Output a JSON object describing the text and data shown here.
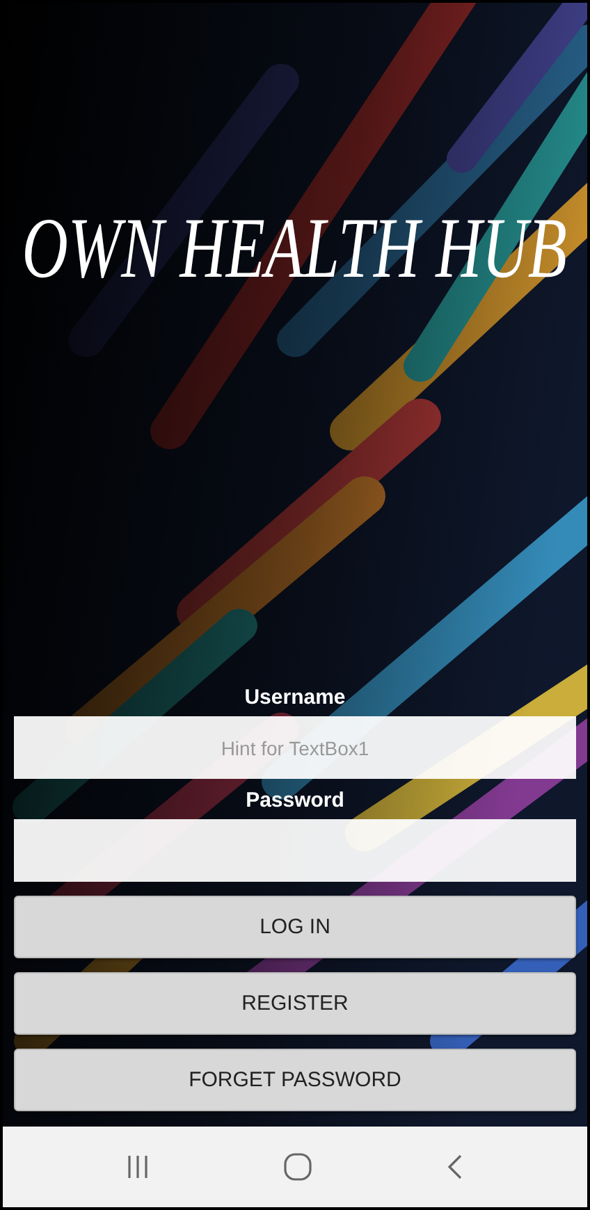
{
  "app": {
    "title": "OWN HEALTH HUB"
  },
  "login_form": {
    "username": {
      "label": "Username",
      "placeholder": "Hint for TextBox1"
    },
    "password": {
      "label": "Password"
    },
    "buttons": [
      "LOG IN",
      "REGISTER",
      "FORGET PASSWORD"
    ]
  },
  "nav_bar": {
    "buttons": [
      {
        "kind": "recents"
      },
      {
        "kind": "home"
      },
      {
        "kind": "back"
      }
    ]
  }
}
